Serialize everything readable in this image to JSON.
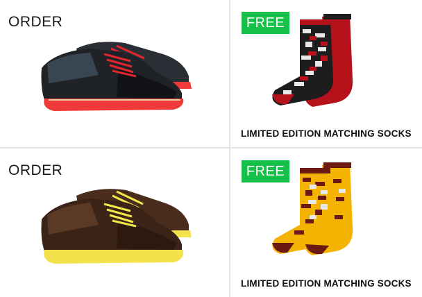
{
  "cards": [
    {
      "order_label": "ORDER",
      "lace_color": "#e3262e",
      "sole_color": "#f03a3a",
      "upper_color": "#1f2227",
      "accent_color": "#3a4552"
    },
    {
      "free_label": "FREE",
      "caption": "LIMITED EDITION MATCHING SOCKS",
      "sock_primary": "#b5121b",
      "sock_secondary": "#1d1d1d",
      "sock_tertiary": "#e8e8e8"
    },
    {
      "order_label": "ORDER",
      "lace_color": "#f2e84a",
      "sole_color": "#f4e24c",
      "upper_color": "#3b2417",
      "accent_color": "#5a3a24"
    },
    {
      "free_label": "FREE",
      "caption": "LIMITED EDITION MATCHING SOCKS",
      "sock_primary": "#f4b300",
      "sock_secondary": "#6b1a12",
      "sock_tertiary": "#e8e8e8"
    }
  ],
  "badge_color": "#16c14a"
}
